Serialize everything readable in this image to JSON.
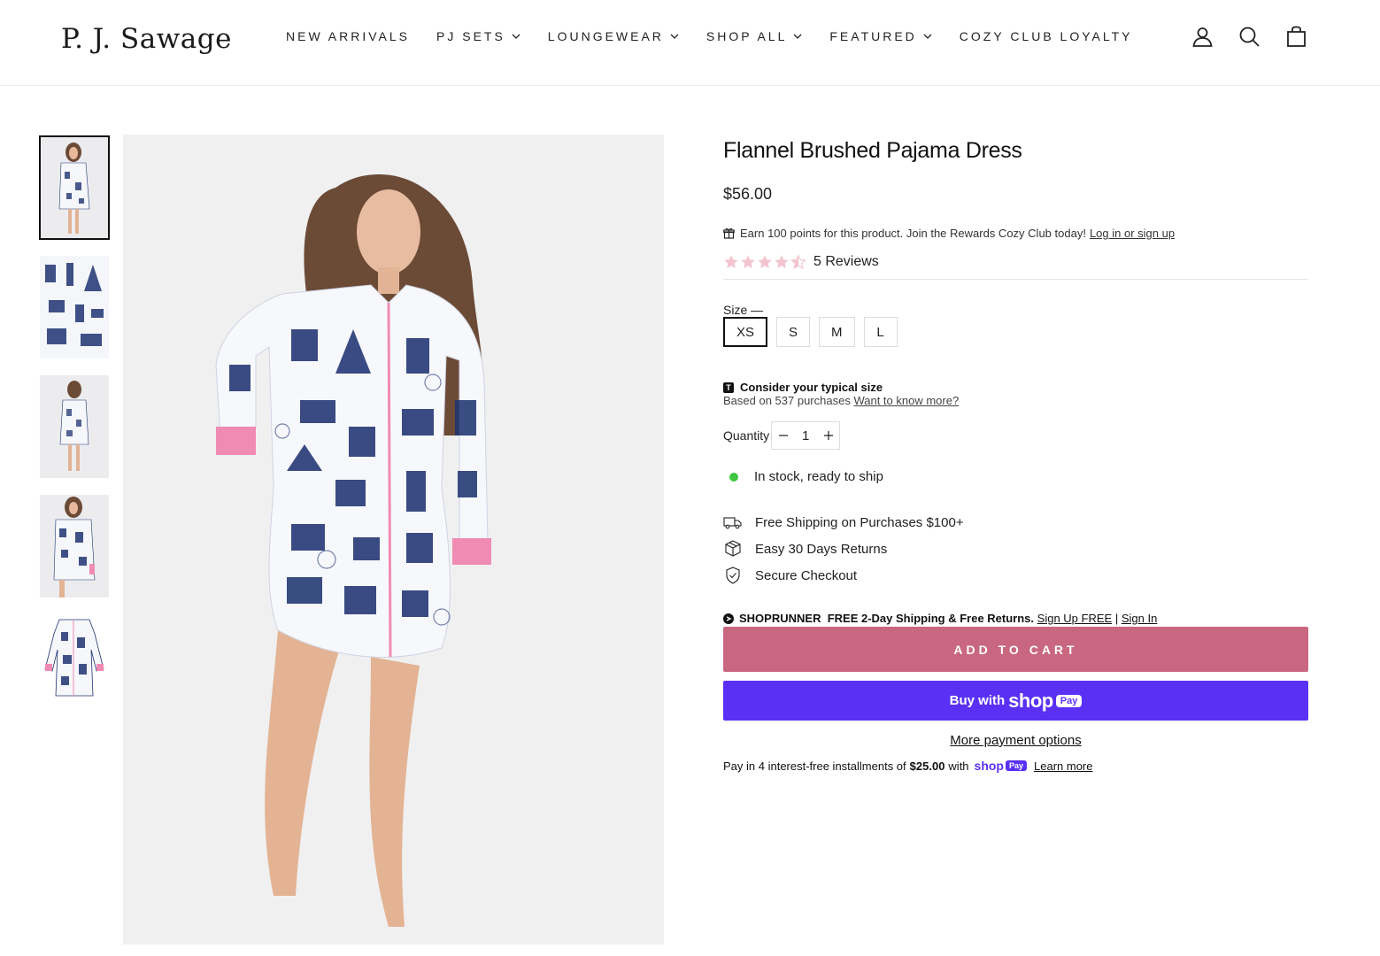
{
  "header": {
    "logo": "P. J. Sawage",
    "nav": [
      {
        "label": "NEW ARRIVALS",
        "has_dropdown": false
      },
      {
        "label": "PJ SETS",
        "has_dropdown": true
      },
      {
        "label": "LOUNGEWEAR",
        "has_dropdown": true
      },
      {
        "label": "SHOP ALL",
        "has_dropdown": true
      },
      {
        "label": "FEATURED",
        "has_dropdown": true
      },
      {
        "label": "COZY CLUB LOYALTY",
        "has_dropdown": false
      }
    ],
    "icons": [
      "account-icon",
      "search-icon",
      "cart-icon"
    ]
  },
  "product": {
    "title": "Flannel Brushed Pajama Dress",
    "price": "$56.00",
    "rewards_text": "Earn 100 points for this product. Join the Rewards Cozy Club today!",
    "rewards_link": "Log in or sign up",
    "rating": 4.5,
    "reviews_label": "5 Reviews",
    "size_label": "Size —",
    "sizes": [
      "XS",
      "S",
      "M",
      "L"
    ],
    "selected_size": "XS",
    "fit_title": "Consider your typical size",
    "fit_sub": "Based on 537 purchases",
    "fit_link": "Want to know more?",
    "quantity_label": "Quantity",
    "quantity": "1",
    "stock_text": "In stock, ready to ship",
    "features": [
      {
        "icon": "truck-icon",
        "label": "Free Shipping on Purchases $100+"
      },
      {
        "icon": "box-icon",
        "label": "Easy 30 Days Returns"
      },
      {
        "icon": "shield-check-icon",
        "label": "Secure Checkout"
      }
    ],
    "shoprunner": {
      "brand": "SHOPRUNNER",
      "text": "FREE 2-Day Shipping & Free Returns.",
      "signup": "Sign Up FREE",
      "separator": "|",
      "signin": "Sign In"
    },
    "add_to_cart": "ADD TO CART",
    "shop_pay": {
      "prefix": "Buy with",
      "brand": "shop",
      "badge": "Pay"
    },
    "more_payment": "More payment options",
    "installments": {
      "prefix": "Pay in 4 interest-free installments of",
      "amount": "$25.00",
      "with": "with",
      "brand": "shop",
      "badge": "Pay",
      "link": "Learn more"
    }
  },
  "colors": {
    "accent": "#c96680",
    "shop_pay": "#5a31f4",
    "in_stock": "#3ec63e",
    "print_navy": "#1f3472",
    "piping_pink": "#f08bb3"
  }
}
